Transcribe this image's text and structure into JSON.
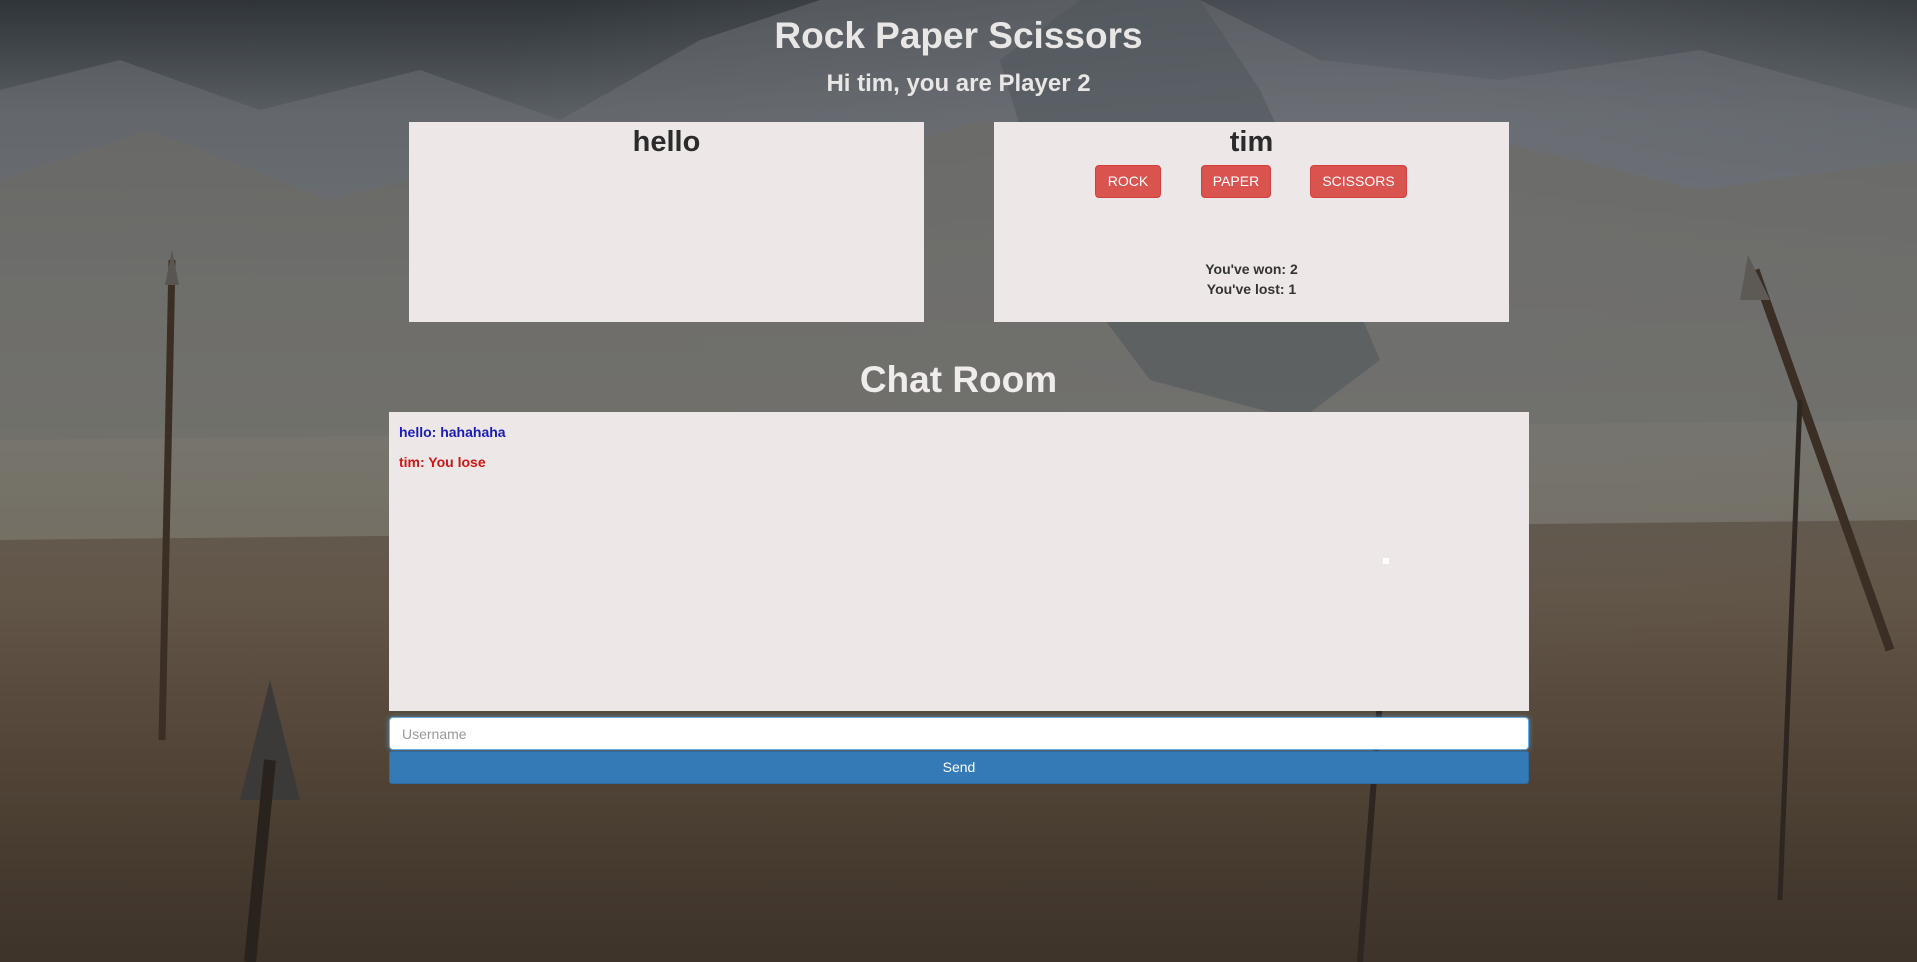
{
  "header": {
    "title": "Rock Paper Scissors",
    "subtitle": "Hi tim, you are Player 2"
  },
  "players": {
    "opponent": {
      "name": "hello"
    },
    "self": {
      "name": "tim",
      "choices": {
        "rock": "ROCK",
        "paper": "PAPER",
        "scissors": "SCISSORS"
      },
      "won_text": "You've won: 2",
      "lost_text": "You've lost: 1"
    }
  },
  "chat": {
    "title": "Chat Room",
    "messages": [
      {
        "text": "hello: hahahaha",
        "color": "#1b1bb8"
      },
      {
        "text": "tim: You lose",
        "color": "#d11414"
      }
    ],
    "input_placeholder": "Username",
    "send_label": "Send"
  },
  "colors": {
    "choice_button": "#d9534f",
    "send_button": "#337ab7",
    "panel_bg": "#ede8e7"
  }
}
